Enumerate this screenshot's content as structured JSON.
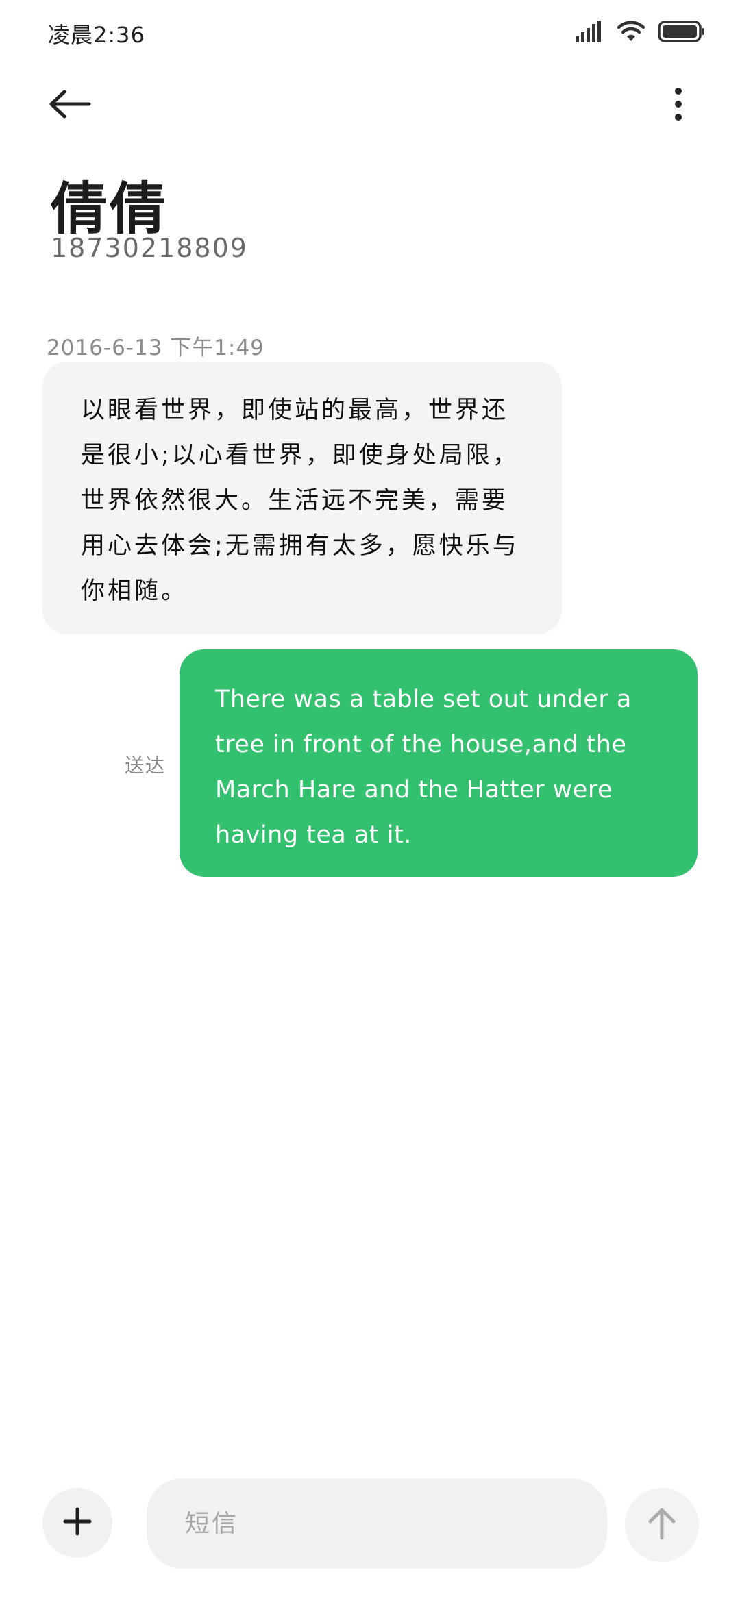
{
  "status_bar": {
    "time": "凌晨2:36",
    "icons": [
      "signal-icon",
      "wifi-icon",
      "battery-icon"
    ]
  },
  "top_bar": {
    "back_icon": "back-arrow-icon",
    "more_icon": "more-vertical-icon"
  },
  "contact": {
    "name": "倩倩",
    "number": "18730218809"
  },
  "conversation": {
    "timestamp": "2016-6-13  下午1:49",
    "messages": [
      {
        "direction": "incoming",
        "text": "以眼看世界，即使站的最高，世界还是很小;以心看世界，即使身处局限，世界依然很大。生活远不完美，需要用心去体会;无需拥有太多，愿快乐与你相随。"
      },
      {
        "direction": "outgoing",
        "text": "There was a table set out under a tree in front of the house,and the March Hare and the Hatter were having tea at it.",
        "status": "送达"
      }
    ]
  },
  "composer": {
    "placeholder": "短信",
    "value": "",
    "add_icon": "plus-icon",
    "send_icon": "arrow-up-icon"
  },
  "colors": {
    "outgoing_bubble": "#33c06f",
    "incoming_bubble": "#f4f4f4",
    "composer_bg": "#f1f1f1"
  }
}
